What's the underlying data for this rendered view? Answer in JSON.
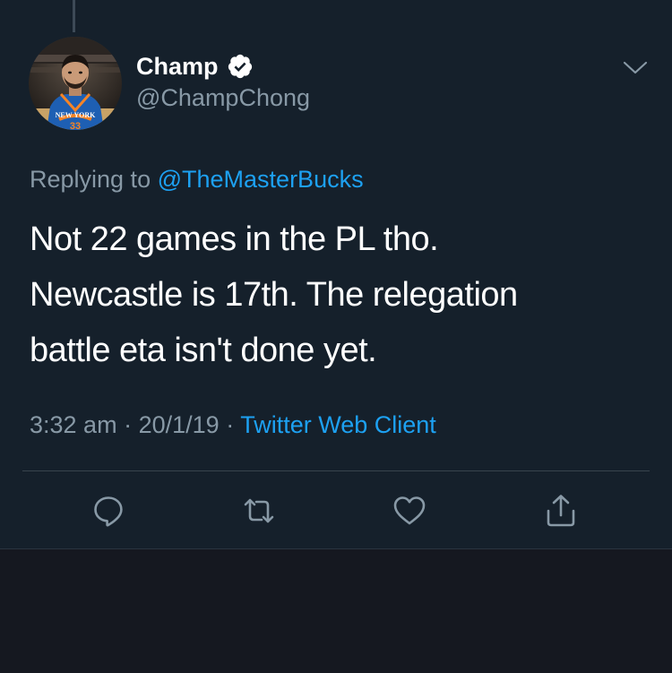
{
  "tweet": {
    "author": {
      "display_name": "Champ",
      "handle": "@ChampChong",
      "verified": true,
      "avatar_jersey_text": "NEW YORK",
      "avatar_jersey_number": "33"
    },
    "reply_context": {
      "prefix": "Replying to",
      "mention": "@TheMasterBucks"
    },
    "text_lines": [
      "Not 22 games in the PL tho.",
      "Newcastle is 17th. The relegation",
      "battle eta isn't done yet."
    ],
    "meta": {
      "time": "3:32 am",
      "separator": "·",
      "date": "20/1/19",
      "source": "Twitter Web Client"
    },
    "actions": [
      "reply-icon",
      "retweet-icon",
      "like-icon",
      "share-icon"
    ]
  },
  "colors": {
    "background": "#15202b",
    "text_primary": "#ffffff",
    "text_secondary": "#8899a6",
    "accent": "#1da1f2"
  }
}
